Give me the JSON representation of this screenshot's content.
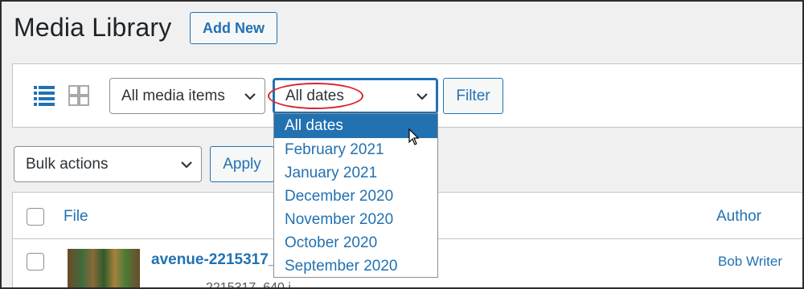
{
  "header": {
    "title": "Media Library",
    "add_new_label": "Add New"
  },
  "toolbar": {
    "view_icons": [
      "list-view-icon",
      "grid-view-icon"
    ],
    "media_filter": {
      "selected": "All media items"
    },
    "date_filter": {
      "selected": "All dates",
      "options": [
        "All dates",
        "February 2021",
        "January 2021",
        "December 2020",
        "November 2020",
        "October 2020",
        "September 2020"
      ]
    },
    "filter_label": "Filter"
  },
  "bulk": {
    "selected": "Bulk actions",
    "apply_label": "Apply"
  },
  "table": {
    "columns": {
      "file": "File",
      "author": "Author"
    },
    "rows": [
      {
        "file_name": "avenue-2215317_",
        "file_sub": "2215317_640.j",
        "author": "Bob Writer"
      }
    ]
  },
  "colors": {
    "accent": "#2271b1",
    "annotation": "#d9232e"
  }
}
